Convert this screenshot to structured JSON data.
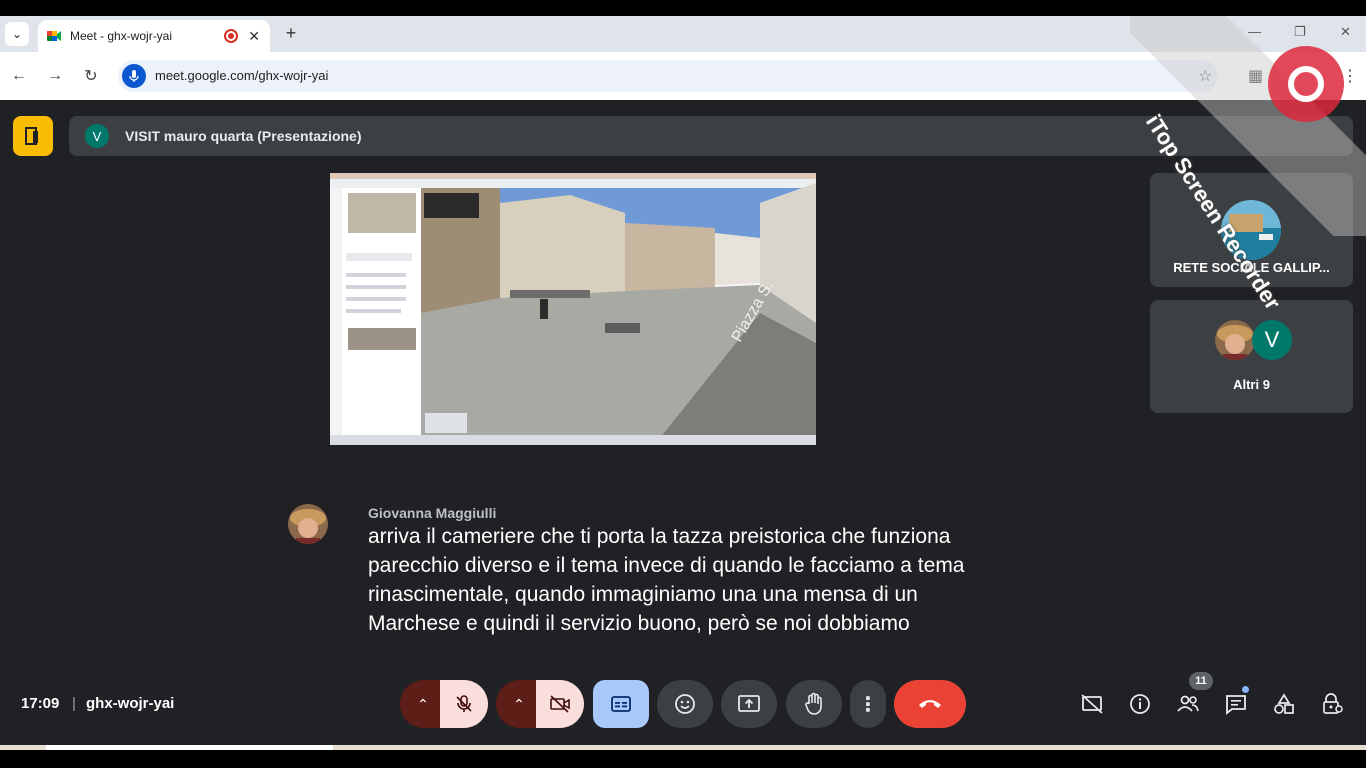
{
  "browser": {
    "tab_title": "Meet - ghx-wojr-yai",
    "new_tab_label": "+",
    "url": "meet.google.com/ghx-wojr-yai"
  },
  "meet": {
    "presenter_initial": "V",
    "presentation_title": "VISIT mauro quarta (Presentazione)",
    "tiles": [
      {
        "name": "RETE SOCIALE GALLIP..."
      },
      {
        "name": "Altri 9",
        "initial": "V"
      }
    ],
    "caption": {
      "speaker": "Giovanna Maggiulli",
      "lines": [
        "arriva il cameriere che ti porta la tazza preistorica che funziona",
        "parecchio diverso e il tema invece di quando le facciamo a tema",
        "rinascimentale, quando immaginiamo una una mensa di un",
        "Marchese e quindi il servizio buono, però se noi dobbiamo"
      ]
    },
    "footer": {
      "time": "17:09",
      "separator": "|",
      "meeting_code": "ghx-wojr-yai",
      "participants_count": "11"
    },
    "shared_screen": {
      "street_label": "Piazza S."
    }
  },
  "watermark": {
    "text": "iTop Screen Recorder"
  },
  "colors": {
    "meet_bg": "#202124",
    "tile_bg": "#3c4043",
    "muted_red": "#f9dedc",
    "muted_dark": "#5c1e16",
    "cc_blue": "#a8c7fa",
    "hangup_red": "#ea4335",
    "present_yellow": "#fbbc04"
  }
}
